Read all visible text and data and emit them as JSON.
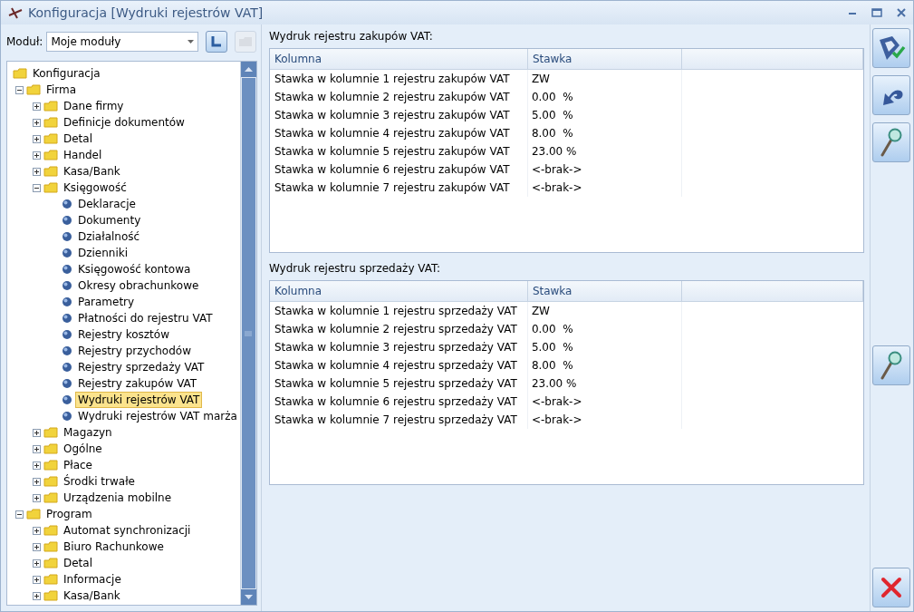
{
  "window": {
    "title": "Konfiguracja [Wydruki rejestrów VAT]"
  },
  "module": {
    "label": "Moduł:",
    "value": "Moje moduły"
  },
  "tree": [
    {
      "label": "Konfiguracja",
      "kind": "folder",
      "expanded": true,
      "selected": false,
      "children": [
        {
          "label": "Firma",
          "kind": "folder",
          "expanded": true,
          "selected": false,
          "children": [
            {
              "label": "Dane firmy",
              "kind": "folder",
              "expanded": false,
              "selected": false
            },
            {
              "label": "Definicje dokumentów",
              "kind": "folder",
              "expanded": false,
              "selected": false
            },
            {
              "label": "Detal",
              "kind": "folder",
              "expanded": false,
              "selected": false
            },
            {
              "label": "Handel",
              "kind": "folder",
              "expanded": false,
              "selected": false
            },
            {
              "label": "Kasa/Bank",
              "kind": "folder",
              "expanded": false,
              "selected": false
            },
            {
              "label": "Księgowość",
              "kind": "folder",
              "expanded": true,
              "selected": false,
              "children": [
                {
                  "label": "Deklaracje",
                  "kind": "leaf",
                  "selected": false
                },
                {
                  "label": "Dokumenty",
                  "kind": "leaf",
                  "selected": false
                },
                {
                  "label": "Działalność",
                  "kind": "leaf",
                  "selected": false
                },
                {
                  "label": "Dzienniki",
                  "kind": "leaf",
                  "selected": false
                },
                {
                  "label": "Księgowość kontowa",
                  "kind": "leaf",
                  "selected": false
                },
                {
                  "label": "Okresy obrachunkowe",
                  "kind": "leaf",
                  "selected": false
                },
                {
                  "label": "Parametry",
                  "kind": "leaf",
                  "selected": false
                },
                {
                  "label": "Płatności do rejestru VAT",
                  "kind": "leaf",
                  "selected": false
                },
                {
                  "label": "Rejestry kosztów",
                  "kind": "leaf",
                  "selected": false
                },
                {
                  "label": "Rejestry przychodów",
                  "kind": "leaf",
                  "selected": false
                },
                {
                  "label": "Rejestry sprzedaży VAT",
                  "kind": "leaf",
                  "selected": false
                },
                {
                  "label": "Rejestry zakupów VAT",
                  "kind": "leaf",
                  "selected": false
                },
                {
                  "label": "Wydruki rejestrów VAT",
                  "kind": "leaf",
                  "selected": true
                },
                {
                  "label": "Wydruki rejestrów VAT marża",
                  "kind": "leaf",
                  "selected": false
                }
              ]
            },
            {
              "label": "Magazyn",
              "kind": "folder",
              "expanded": false,
              "selected": false
            },
            {
              "label": "Ogólne",
              "kind": "folder",
              "expanded": false,
              "selected": false
            },
            {
              "label": "Płace",
              "kind": "folder",
              "expanded": false,
              "selected": false
            },
            {
              "label": "Środki trwałe",
              "kind": "folder",
              "expanded": false,
              "selected": false
            },
            {
              "label": "Urządzenia mobilne",
              "kind": "folder",
              "expanded": false,
              "selected": false
            }
          ]
        },
        {
          "label": "Program",
          "kind": "folder",
          "expanded": true,
          "selected": false,
          "children": [
            {
              "label": "Automat synchronizacji",
              "kind": "folder",
              "expanded": false,
              "selected": false
            },
            {
              "label": "Biuro Rachunkowe",
              "kind": "folder",
              "expanded": false,
              "selected": false
            },
            {
              "label": "Detal",
              "kind": "folder",
              "expanded": false,
              "selected": false
            },
            {
              "label": "Informacje",
              "kind": "folder",
              "expanded": false,
              "selected": false
            },
            {
              "label": "Kasa/Bank",
              "kind": "folder",
              "expanded": false,
              "selected": false
            }
          ]
        }
      ]
    }
  ],
  "sections": [
    {
      "title": "Wydruk rejestru zakupów VAT:",
      "columns": [
        "Kolumna",
        "Stawka"
      ],
      "rows": [
        [
          "Stawka w kolumnie 1 rejestru zakupów VAT",
          "ZW"
        ],
        [
          "Stawka w kolumnie 2 rejestru zakupów VAT",
          "0.00  %"
        ],
        [
          "Stawka w kolumnie 3 rejestru zakupów VAT",
          "5.00  %"
        ],
        [
          "Stawka w kolumnie 4 rejestru zakupów VAT",
          "8.00  %"
        ],
        [
          "Stawka w kolumnie 5 rejestru zakupów VAT",
          "23.00 %"
        ],
        [
          "Stawka w kolumnie 6 rejestru zakupów VAT",
          "<-brak->"
        ],
        [
          "Stawka w kolumnie 7 rejestru zakupów VAT",
          "<-brak->"
        ]
      ]
    },
    {
      "title": "Wydruk rejestru sprzedaży VAT:",
      "columns": [
        "Kolumna",
        "Stawka"
      ],
      "rows": [
        [
          "Stawka w kolumnie 1 rejestru sprzedaży VAT",
          "ZW"
        ],
        [
          "Stawka w kolumnie 2 rejestru sprzedaży VAT",
          "0.00  %"
        ],
        [
          "Stawka w kolumnie 3 rejestru sprzedaży VAT",
          "5.00  %"
        ],
        [
          "Stawka w kolumnie 4 rejestru sprzedaży VAT",
          "8.00  %"
        ],
        [
          "Stawka w kolumnie 5 rejestru sprzedaży VAT",
          "23.00 %"
        ],
        [
          "Stawka w kolumnie 6 rejestru sprzedaży VAT",
          "<-brak->"
        ],
        [
          "Stawka w kolumnie 7 rejestru sprzedaży VAT",
          "<-brak->"
        ]
      ]
    }
  ],
  "toolbar": [
    {
      "kind": "save"
    },
    {
      "kind": "undo"
    },
    {
      "kind": "preview"
    },
    {
      "kind": "spacer"
    },
    {
      "kind": "preview"
    },
    {
      "kind": "spacer"
    },
    {
      "kind": "close"
    }
  ]
}
